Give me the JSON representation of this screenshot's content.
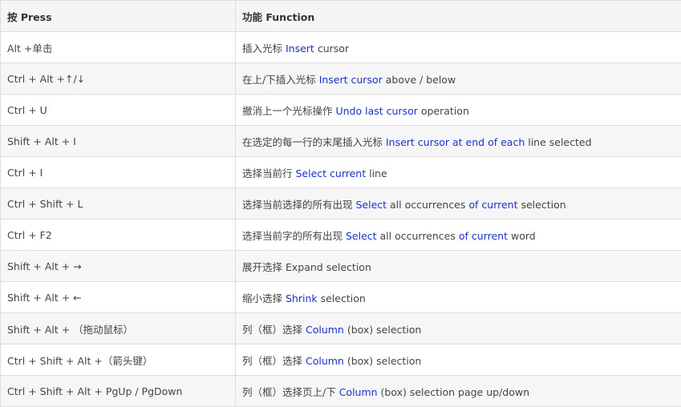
{
  "table": {
    "headers": [
      "按 Press",
      "功能 Function"
    ],
    "rows": [
      {
        "press": "Alt +单击",
        "function": [
          {
            "t": "插入光标 "
          },
          {
            "t": "Insert",
            "hl": true
          },
          {
            "t": " cursor"
          }
        ]
      },
      {
        "press": "Ctrl + Alt +↑/↓",
        "function": [
          {
            "t": "在上/下插入光标 "
          },
          {
            "t": "Insert cursor",
            "hl": true
          },
          {
            "t": " above / below"
          }
        ]
      },
      {
        "press": "Ctrl + U",
        "function": [
          {
            "t": "撤消上一个光标操作 "
          },
          {
            "t": "Undo last cursor",
            "hl": true
          },
          {
            "t": " operation"
          }
        ]
      },
      {
        "press": "Shift + Alt + I",
        "function": [
          {
            "t": "在选定的每一行的末尾插入光标 "
          },
          {
            "t": "Insert cursor at end of each",
            "hl": true
          },
          {
            "t": " line selected"
          }
        ]
      },
      {
        "press": "Ctrl + I",
        "function": [
          {
            "t": "选择当前行 "
          },
          {
            "t": "Select current",
            "hl": true
          },
          {
            "t": " line"
          }
        ]
      },
      {
        "press": "Ctrl + Shift + L",
        "function": [
          {
            "t": "选择当前选择的所有出现 "
          },
          {
            "t": "Select",
            "hl": true
          },
          {
            "t": " all occurrences "
          },
          {
            "t": "of current",
            "hl": true
          },
          {
            "t": " selection"
          }
        ]
      },
      {
        "press": "Ctrl + F2",
        "function": [
          {
            "t": "选择当前字的所有出现 "
          },
          {
            "t": "Select",
            "hl": true
          },
          {
            "t": " all occurrences "
          },
          {
            "t": "of current",
            "hl": true
          },
          {
            "t": " word"
          }
        ]
      },
      {
        "press": "Shift + Alt + →",
        "function": [
          {
            "t": "展开选择 Expand selection"
          }
        ]
      },
      {
        "press": "Shift + Alt + ←",
        "function": [
          {
            "t": "缩小选择 "
          },
          {
            "t": "Shrink",
            "hl": true
          },
          {
            "t": " selection"
          }
        ]
      },
      {
        "press": "Shift + Alt + （拖动鼠标）",
        "function": [
          {
            "t": "列（框）选择 "
          },
          {
            "t": "Column",
            "hl": true
          },
          {
            "t": " (box) selection"
          }
        ]
      },
      {
        "press": "Ctrl + Shift + Alt +（箭头键）",
        "function": [
          {
            "t": "列（框）选择 "
          },
          {
            "t": "Column",
            "hl": true
          },
          {
            "t": " (box) selection"
          }
        ]
      },
      {
        "press": "Ctrl + Shift + Alt + PgUp / PgDown",
        "function": [
          {
            "t": "列（框）选择页上/下 "
          },
          {
            "t": "Column",
            "hl": true
          },
          {
            "t": " (box) selection page up/down"
          }
        ]
      }
    ]
  },
  "colors": {
    "highlight_text": "#1c31c8",
    "body_text": "#444444",
    "header_bg": "#f5f5f5",
    "stripe_bg": "#f6f6f6",
    "border": "#dddddd"
  }
}
